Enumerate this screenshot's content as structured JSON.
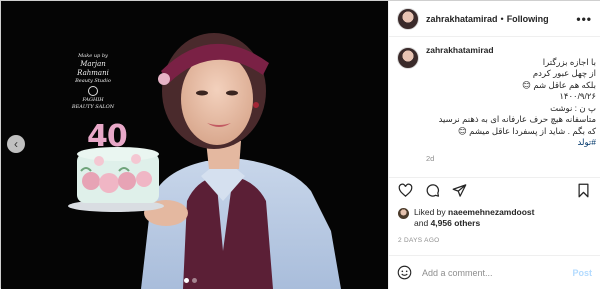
{
  "post": {
    "username": "zahrakhatamirad",
    "follow_separator": "•",
    "follow_label": "Following",
    "more_label": "•••",
    "photo": {
      "brand_line1": "Make up by",
      "brand_line2": "Marjan Rahmani",
      "brand_line3": "Beauty Studio",
      "brand_line4": "FAGHIH",
      "brand_line5": "BEAUTY SALON",
      "cake_number": "40",
      "prev_icon": "chevron-left-icon"
    },
    "caption": {
      "lines": [
        "با اجازه بزرگترا",
        "از چهل عبور کردم",
        "بلکه هم عاقل شم 😊",
        "۱۴۰۰/۹/۲۶",
        "پ ن : نوشت",
        "متاسفانه هیچ حرف عارفانه ای به ذهنم نرسید",
        "که بگم . شاید از پسفردا عاقل میشم 😊"
      ],
      "hashtag": "#تولد",
      "age": "2d"
    },
    "likes": {
      "prefix": "Liked by",
      "user": "naeemehnezamdoost",
      "and": "and",
      "others": "4,956 others"
    },
    "time_ago": "2 DAYS AGO",
    "comment": {
      "placeholder": "Add a comment...",
      "post_label": "Post"
    }
  },
  "colors": {
    "link": "#00376b",
    "post_button": "#b3dbff",
    "muted": "#8e8e8e"
  }
}
